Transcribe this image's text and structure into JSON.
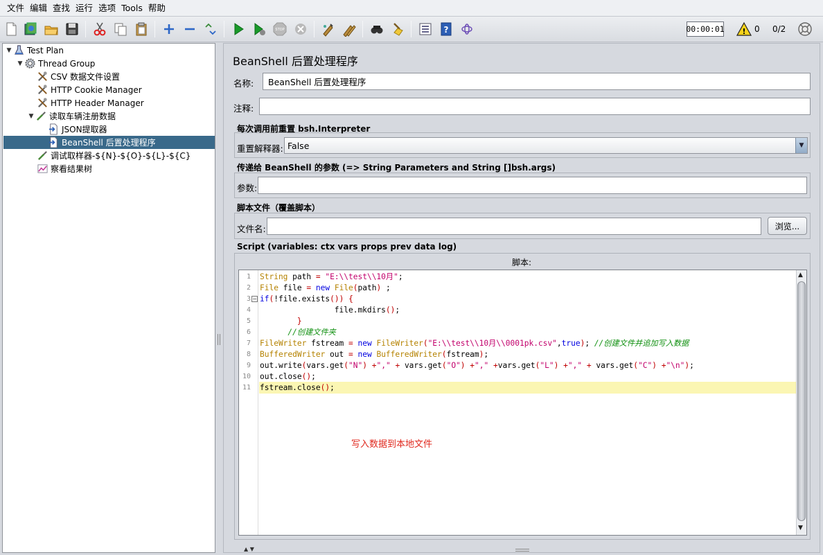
{
  "menu": [
    "文件",
    "编辑",
    "查找",
    "运行",
    "选项",
    "Tools",
    "帮助"
  ],
  "toolbar": {
    "timer": "00:00:01",
    "warning_count": "0",
    "threads": "0/2"
  },
  "tree": {
    "nodes": [
      {
        "label": "Test Plan",
        "icon": "flask-icon"
      },
      {
        "label": "Thread Group",
        "icon": "gear-icon"
      },
      {
        "label": "CSV 数据文件设置",
        "icon": "wrench-icon"
      },
      {
        "label": "HTTP Cookie Manager",
        "icon": "wrench-icon"
      },
      {
        "label": "HTTP Header Manager",
        "icon": "wrench-icon"
      },
      {
        "label": "读取车辆注册数据",
        "icon": "pipette-icon"
      },
      {
        "label": "JSON提取器",
        "icon": "document-arrow-icon"
      },
      {
        "label": "BeanShell 后置处理程序",
        "icon": "document-arrow-icon"
      },
      {
        "label": "调试取样器-${N}-${O}-${L}-${C}",
        "icon": "pipette-icon"
      },
      {
        "label": "察看结果树",
        "icon": "chart-icon"
      }
    ]
  },
  "panel": {
    "title": "BeanShell 后置处理程序",
    "name_label": "名称:",
    "name_value": "BeanShell 后置处理程序",
    "comment_label": "注释:",
    "comment_value": "",
    "reset_group_title": "每次调用前重置 bsh.Interpreter",
    "reset_label": "重置解释器:",
    "reset_value": "False",
    "params_group_title": "传递给 BeanShell 的参数 (=> String Parameters and String []bsh.args)",
    "params_label": "参数:",
    "params_value": "",
    "file_group_title": "脚本文件（覆盖脚本）",
    "file_label": "文件名:",
    "file_value": "",
    "browse_label": "浏览...",
    "script_group_title": "Script (variables: ctx vars props prev data log)",
    "script_label": "脚本:"
  },
  "script_lines": [
    "String path = \"E:\\\\test\\\\10月\";",
    "File file = new File(path) ;",
    "if(!file.exists()) {",
    "                file.mkdirs();",
    "        }",
    "      //创建文件夹",
    "FileWriter fstream = new FileWriter(\"E:\\\\test\\\\10月\\\\0001pk.csv\",true); //创建文件并追加写入数据",
    "BufferedWriter out = new BufferedWriter(fstream);",
    "out.write(vars.get(\"N\") +\",\" + vars.get(\"O\") +\",\" +vars.get(\"L\") +\",\" + vars.get(\"C\") +\"\\n\");",
    "out.close();",
    "fstream.close();"
  ],
  "annotation": "写入数据到本地文件"
}
